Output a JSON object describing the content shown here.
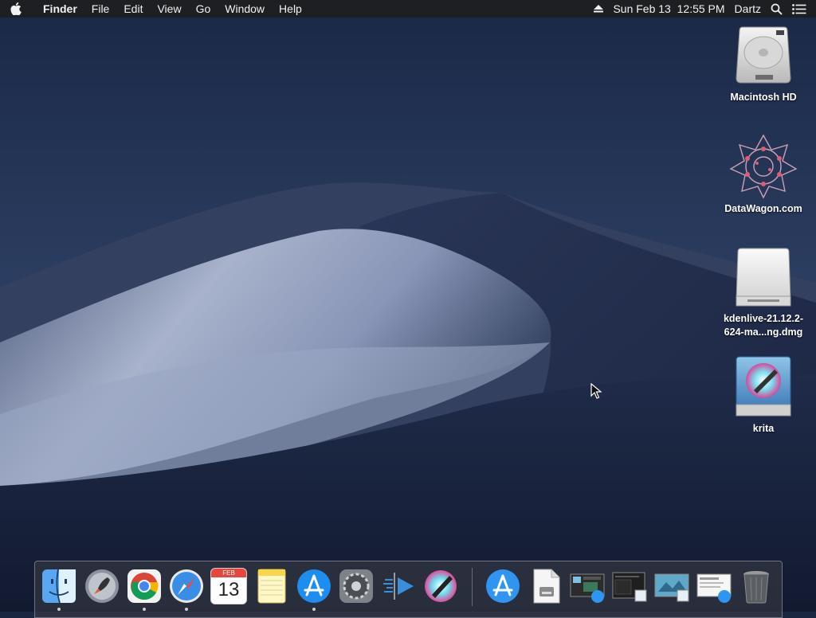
{
  "menubar": {
    "app_name": "Finder",
    "menus": [
      "File",
      "Edit",
      "View",
      "Go",
      "Window",
      "Help"
    ],
    "datetime": "Sun Feb 13  12:55 PM",
    "user": "Dartz"
  },
  "desktop": {
    "icons": [
      {
        "label": "Macintosh HD",
        "icon": "hard-drive-icon"
      },
      {
        "label": "DataWagon.com",
        "icon": "datawagon-logo-icon"
      },
      {
        "label_line1": "kdenlive-21.12.2-",
        "label_line2": "624-ma...ng.dmg",
        "icon": "disk-image-icon"
      },
      {
        "label": "krita",
        "icon": "krita-volume-icon"
      }
    ]
  },
  "dock": {
    "calendar_month": "FEB",
    "calendar_day": "13",
    "items": [
      "Finder",
      "Launchpad",
      "Google Chrome",
      "Safari",
      "Calendar",
      "Notes",
      "App Store",
      "System Preferences",
      "Kdenlive",
      "Krita",
      "Applications",
      "Downloads",
      "Screenshot 1",
      "Screenshot 2",
      "Screenshot 3",
      "Screenshot 4",
      "Trash"
    ]
  },
  "colors": {
    "menubar_bg": "#1e1e20",
    "sky_top": "#1a2846",
    "dune_light": "#c9cfe0"
  }
}
